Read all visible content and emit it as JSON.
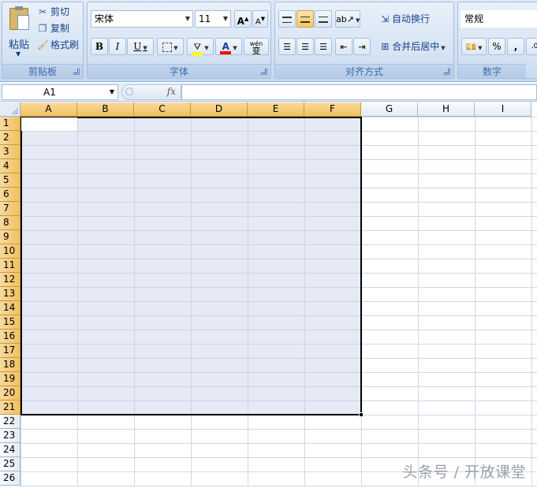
{
  "ribbon": {
    "clipboard": {
      "paste_label": "粘贴",
      "cut_label": "剪切",
      "copy_label": "复制",
      "format_painter_label": "格式刷",
      "group_label": "剪贴板"
    },
    "font": {
      "font_name": "宋体",
      "font_size": "11",
      "bold": "B",
      "italic": "I",
      "underline": "U",
      "grow_font": "A",
      "shrink_font": "A",
      "font_color_glyph": "A",
      "phonetic_glyph": "wén",
      "phonetic_char": "变",
      "group_label": "字体"
    },
    "alignment": {
      "wrap_text_label": "自动换行",
      "merge_center_label": "合并后居中",
      "group_label": "对齐方式"
    },
    "number": {
      "format_value": "常规",
      "percent": "%",
      "comma": ",",
      "group_label": "数字"
    }
  },
  "formula_bar": {
    "name_box": "A1",
    "fx": "fx",
    "formula": ""
  },
  "sheet": {
    "columns": [
      "A",
      "B",
      "C",
      "D",
      "E",
      "F",
      "G",
      "H",
      "I"
    ],
    "rows": [
      "1",
      "2",
      "3",
      "4",
      "5",
      "6",
      "7",
      "8",
      "9",
      "10",
      "11",
      "12",
      "13",
      "14",
      "15",
      "16",
      "17",
      "18",
      "19",
      "20",
      "21",
      "22",
      "23",
      "24",
      "25",
      "26"
    ],
    "selection": "A1:F21",
    "active_cell": "A1"
  },
  "watermark": "头条号 / 开放课堂",
  "colors": {
    "selection_fill": "#e6e8f4",
    "header_selected": "#f5c870",
    "gridline": "#d0d7e5",
    "ribbon_text": "#15428b"
  }
}
